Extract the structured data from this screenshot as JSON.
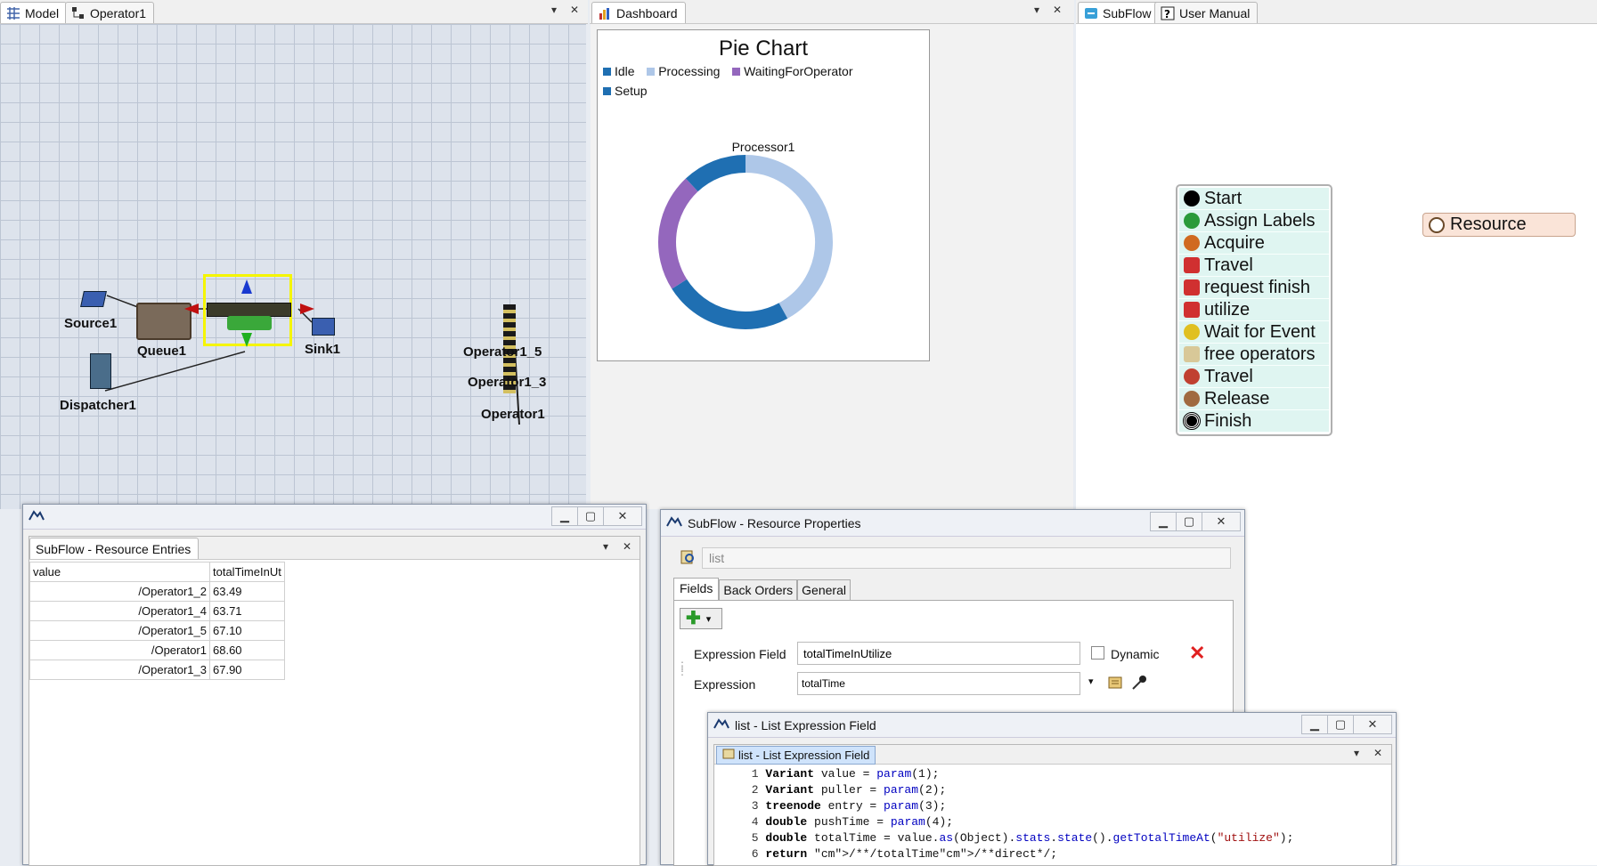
{
  "left_tabs": {
    "model": "Model",
    "operator": "Operator1"
  },
  "model_objects": {
    "source": "Source1",
    "queue": "Queue1",
    "sink": "Sink1",
    "dispatcher": "Dispatcher1",
    "op5": "Operator1_5",
    "op3": "Operator1_3",
    "op1": "Operator1"
  },
  "dashboard": {
    "tab": "Dashboard",
    "title": "Pie Chart",
    "legend": [
      {
        "label": "Idle",
        "color": "#1f6fb2"
      },
      {
        "label": "Processing",
        "color": "#aec7e8"
      },
      {
        "label": "WaitingForOperator",
        "color": "#9467bd"
      },
      {
        "label": "Setup",
        "color": "#1f6fb2"
      }
    ],
    "chart_label": "Processor1"
  },
  "chart_data": {
    "type": "pie",
    "title": "Pie Chart",
    "subtitle": "Processor1",
    "series": [
      {
        "name": "Processing",
        "value": 42,
        "color": "#aec7e8"
      },
      {
        "name": "Idle",
        "value": 24,
        "color": "#1f6fb2"
      },
      {
        "name": "WaitingForOperator",
        "value": 22,
        "color": "#9467bd"
      },
      {
        "name": "Setup",
        "value": 12,
        "color": "#1f6fb2"
      }
    ]
  },
  "subflow_tabs": {
    "subflow": "SubFlow",
    "manual": "User Manual"
  },
  "flow_items": [
    "Start",
    "Assign Labels",
    "Acquire",
    "Travel",
    "request finish",
    "utilize",
    "Wait for Event",
    "free operators",
    "Travel",
    "Release",
    "Finish"
  ],
  "resource_node": "Resource",
  "entries_window": {
    "title": "SubFlow - Resource Entries",
    "columns": [
      "value",
      "totalTimeInUt"
    ],
    "rows": [
      [
        "/Operator1_2",
        "63.49"
      ],
      [
        "/Operator1_4",
        "63.71"
      ],
      [
        "/Operator1_5",
        "67.10"
      ],
      [
        "/Operator1",
        "68.60"
      ],
      [
        "/Operator1_3",
        "67.90"
      ]
    ]
  },
  "props_window": {
    "title": "SubFlow - Resource Properties",
    "name_value": "list",
    "tabs": [
      "Fields",
      "Back Orders",
      "General"
    ],
    "expression_field_label": "Expression Field",
    "expression_field_value": "totalTimeInUtilize",
    "dynamic_label": "Dynamic",
    "expression_label": "Expression",
    "expression_value": "totalTime"
  },
  "list_window": {
    "title": "list - List Expression Field",
    "tab": "list - List Expression Field",
    "code": [
      {
        "n": "1",
        "t": "Variant value = param(1);"
      },
      {
        "n": "2",
        "t": "Variant puller = param(2);"
      },
      {
        "n": "3",
        "t": "treenode entry = param(3);"
      },
      {
        "n": "4",
        "t": "double pushTime = param(4);"
      },
      {
        "n": "5",
        "t": "double totalTime = value.as(Object).stats.state().getTotalTimeAt(\"utilize\");"
      },
      {
        "n": "6",
        "t": "return /**/totalTime/**direct*/;"
      }
    ]
  }
}
